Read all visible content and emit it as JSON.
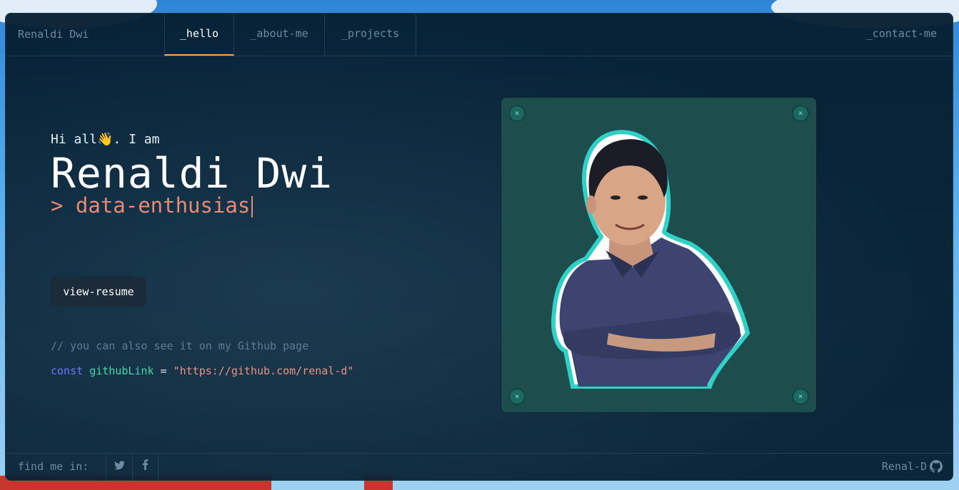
{
  "header": {
    "brand": "Renaldi Dwi",
    "tabs": [
      {
        "label": "_hello",
        "active": true
      },
      {
        "label": "_about-me",
        "active": false
      },
      {
        "label": "_projects",
        "active": false
      }
    ],
    "contact": "_contact-me"
  },
  "hero": {
    "greeting": "Hi all👋. I am",
    "name": "Renaldi Dwi",
    "role_prefix": "> ",
    "role": "data-enthusias",
    "resume_label": "view-resume",
    "comment": "// you can also see it on my Github page",
    "code": {
      "keyword": "const",
      "variable": "githubLink",
      "operator": " = ",
      "value": "\"https://github.com/renal-d\""
    }
  },
  "photo": {
    "corner_glyph": "×"
  },
  "footer": {
    "find_label": "find me in:",
    "socials": [
      "twitter-icon",
      "facebook-icon"
    ],
    "github_user": "Renal-D"
  },
  "colors": {
    "accent_tab": "#f1a65d",
    "role": "#e98a74",
    "keyword": "#6b79f0",
    "variable": "#43d9ad",
    "string": "#e99287"
  }
}
